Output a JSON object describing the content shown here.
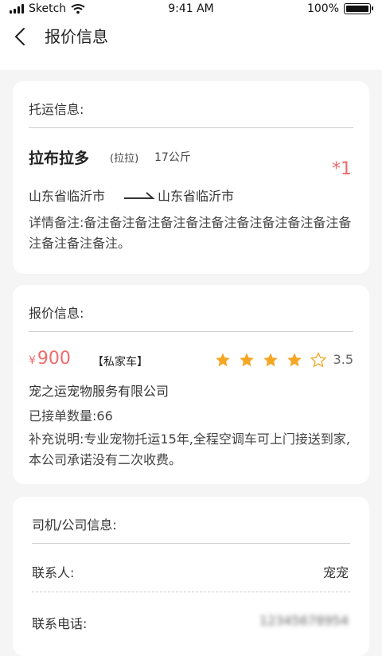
{
  "status": {
    "carrier": "Sketch",
    "time": "9:41 AM",
    "battery": "100%",
    "battery_level": 1.0
  },
  "nav": {
    "back_icon": "chevron-left-icon",
    "title": "报价信息"
  },
  "shipping": {
    "section_title": "托运信息:",
    "pet_name": "拉布拉多",
    "breed_tag": "(拉拉)",
    "weight": "17公斤",
    "count": "*1",
    "from": "山东省临沂市",
    "to": "山东省临沂市",
    "arrow_icon": "right-arrow-icon",
    "note": "详情备注:备注备注备注备注备注备注备注备注备注备注备注备注备注备注。"
  },
  "quote": {
    "section_title": "报价信息:",
    "currency": "¥",
    "price": "900",
    "vehicle_tag": "【私家车】",
    "rating": "3.5",
    "rating_value": 3.5,
    "rating_max": 5,
    "company": "宠之运宠物服务有限公司",
    "orders": "已接单数量:66",
    "extra": "补充说明:专业宠物托运15年,全程空调车可上门接送到家,本公司承诺没有二次收费。"
  },
  "contact": {
    "section_title": "司机/公司信息:",
    "contact_label": "联系人:",
    "contact_value": "宠宠",
    "phone_label": "联系电话:",
    "phone_value": "12345678954"
  },
  "colors": {
    "accent_red": "#f06b6b",
    "star_gold": "#f5a623"
  }
}
